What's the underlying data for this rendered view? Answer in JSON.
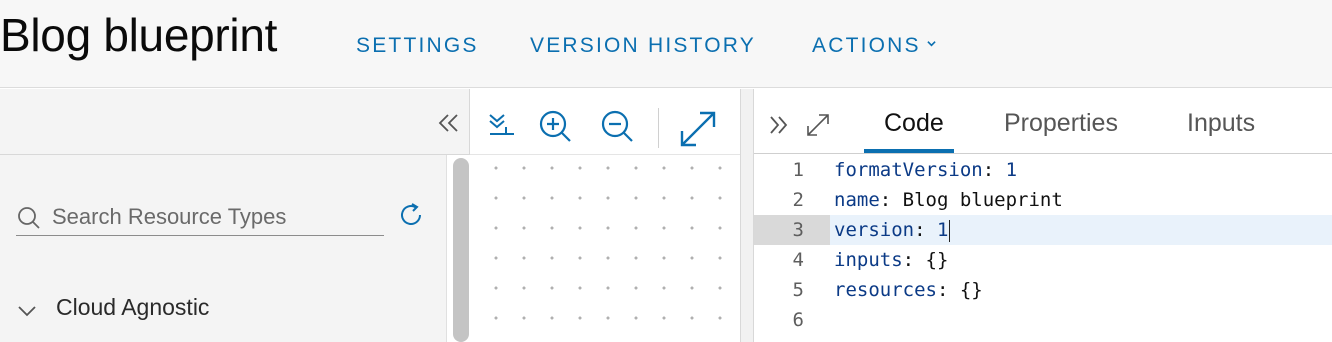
{
  "header": {
    "title": "Blog blueprint",
    "nav": {
      "settings": "SETTINGS",
      "version_history": "VERSION HISTORY",
      "actions": "ACTIONS"
    }
  },
  "palette": {
    "search": {
      "placeholder": "Search Resource Types",
      "value": ""
    },
    "categories": [
      {
        "label": "Cloud Agnostic",
        "expanded": true
      }
    ],
    "icons": [
      "collapse-left-icon",
      "search-icon",
      "refresh-icon",
      "chevron-down-icon"
    ]
  },
  "canvas": {
    "toolbar_icons": [
      "align-bottom-icon",
      "zoom-in-icon",
      "zoom-out-icon",
      "fit-to-screen-icon"
    ]
  },
  "editor_panel": {
    "tabs": [
      {
        "label": "Code",
        "active": true
      },
      {
        "label": "Properties",
        "active": false
      },
      {
        "label": "Inputs",
        "active": false
      }
    ],
    "icons": [
      "expand-right-icon",
      "maximize-icon"
    ],
    "lines": [
      {
        "num": "1",
        "key": "formatVersion",
        "sep": ": ",
        "value": "1",
        "value_type": "number"
      },
      {
        "num": "2",
        "key": "name",
        "sep": ": ",
        "value": "Blog blueprint",
        "value_type": "string"
      },
      {
        "num": "3",
        "key": "version",
        "sep": ": ",
        "value": "1",
        "value_type": "number",
        "current": true
      },
      {
        "num": "4",
        "key": "inputs",
        "sep": ": ",
        "value": "{}",
        "value_type": "object"
      },
      {
        "num": "5",
        "key": "resources",
        "sep": ": ",
        "value": "{}",
        "value_type": "object"
      },
      {
        "num": "6",
        "key": "",
        "sep": "",
        "value": "",
        "value_type": "empty"
      }
    ]
  },
  "colors": {
    "accent": "#0b6fb0",
    "header_bg": "#f7f7f7",
    "palette_bg": "#f4f4f4",
    "code_key": "#0b3a86",
    "current_line": "#e9f2fb"
  }
}
